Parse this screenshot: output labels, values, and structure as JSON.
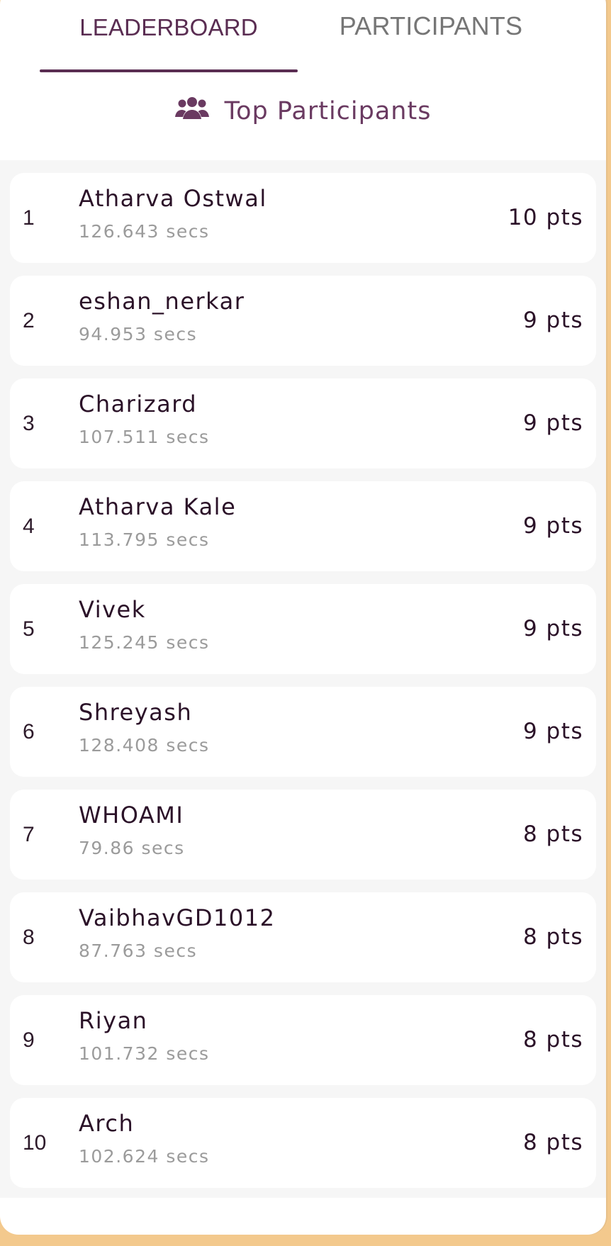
{
  "tabs": {
    "leaderboard": "LEADERBOARD",
    "participants": "PARTICIPANTS",
    "active": "leaderboard"
  },
  "section": {
    "title": "Top Participants",
    "icon": "users-icon"
  },
  "leaderboard": [
    {
      "rank": "1",
      "name": "Atharva Ostwal",
      "time": "126.643 secs",
      "points": "10 pts"
    },
    {
      "rank": "2",
      "name": "eshan_nerkar",
      "time": "94.953 secs",
      "points": "9 pts"
    },
    {
      "rank": "3",
      "name": "Charizard",
      "time": "107.511 secs",
      "points": "9 pts"
    },
    {
      "rank": "4",
      "name": "Atharva Kale",
      "time": "113.795 secs",
      "points": "9 pts"
    },
    {
      "rank": "5",
      "name": "Vivek",
      "time": "125.245 secs",
      "points": "9 pts"
    },
    {
      "rank": "6",
      "name": "Shreyash",
      "time": "128.408 secs",
      "points": "9 pts"
    },
    {
      "rank": "7",
      "name": "WHOAMI",
      "time": "79.86 secs",
      "points": "8 pts"
    },
    {
      "rank": "8",
      "name": "VaibhavGD1012",
      "time": "87.763 secs",
      "points": "8 pts"
    },
    {
      "rank": "9",
      "name": "Riyan",
      "time": "101.732 secs",
      "points": "8 pts"
    },
    {
      "rank": "10",
      "name": "Arch",
      "time": "102.624 secs",
      "points": "8 pts"
    }
  ],
  "colors": {
    "accent": "#5a2d52",
    "background": "#f3c98d",
    "list_background": "#f6f6f6",
    "muted_text": "#9b9b9b"
  }
}
